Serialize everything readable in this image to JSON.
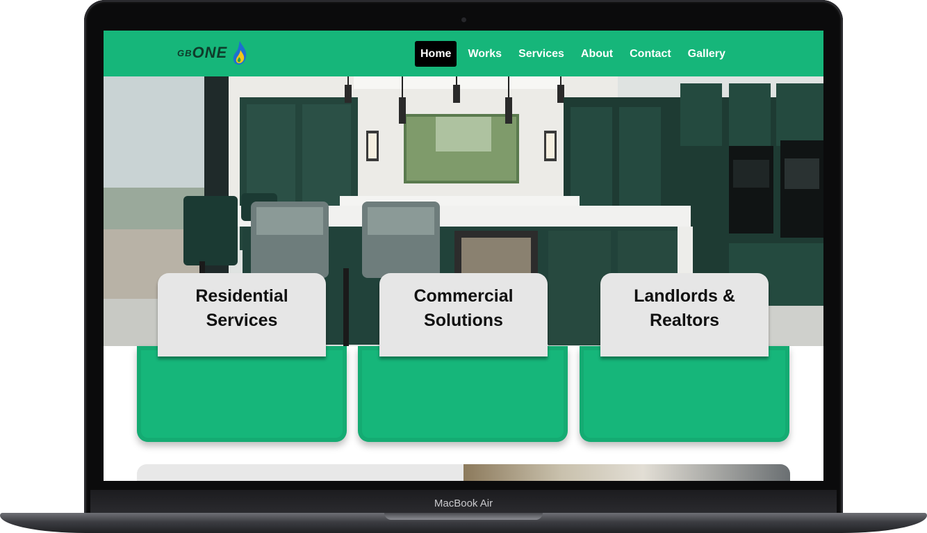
{
  "device": {
    "label": "MacBook Air"
  },
  "site": {
    "logo": {
      "prefix": "GB",
      "name": "ONE",
      "icon": "flame-icon"
    },
    "nav": [
      {
        "label": "Home",
        "active": true
      },
      {
        "label": "Works",
        "active": false
      },
      {
        "label": "Services",
        "active": false
      },
      {
        "label": "About",
        "active": false
      },
      {
        "label": "Contact",
        "active": false
      },
      {
        "label": "Gallery",
        "active": false
      }
    ],
    "colors": {
      "brand_green": "#16b67a",
      "nav_active_bg": "#000000",
      "card_top": "#e6e6e6"
    },
    "hero": {
      "image": "kitchen-photo"
    },
    "cards": [
      {
        "title": "Residential Services"
      },
      {
        "title": "Commercial Solutions"
      },
      {
        "title": "Landlords & Realtors"
      }
    ]
  }
}
